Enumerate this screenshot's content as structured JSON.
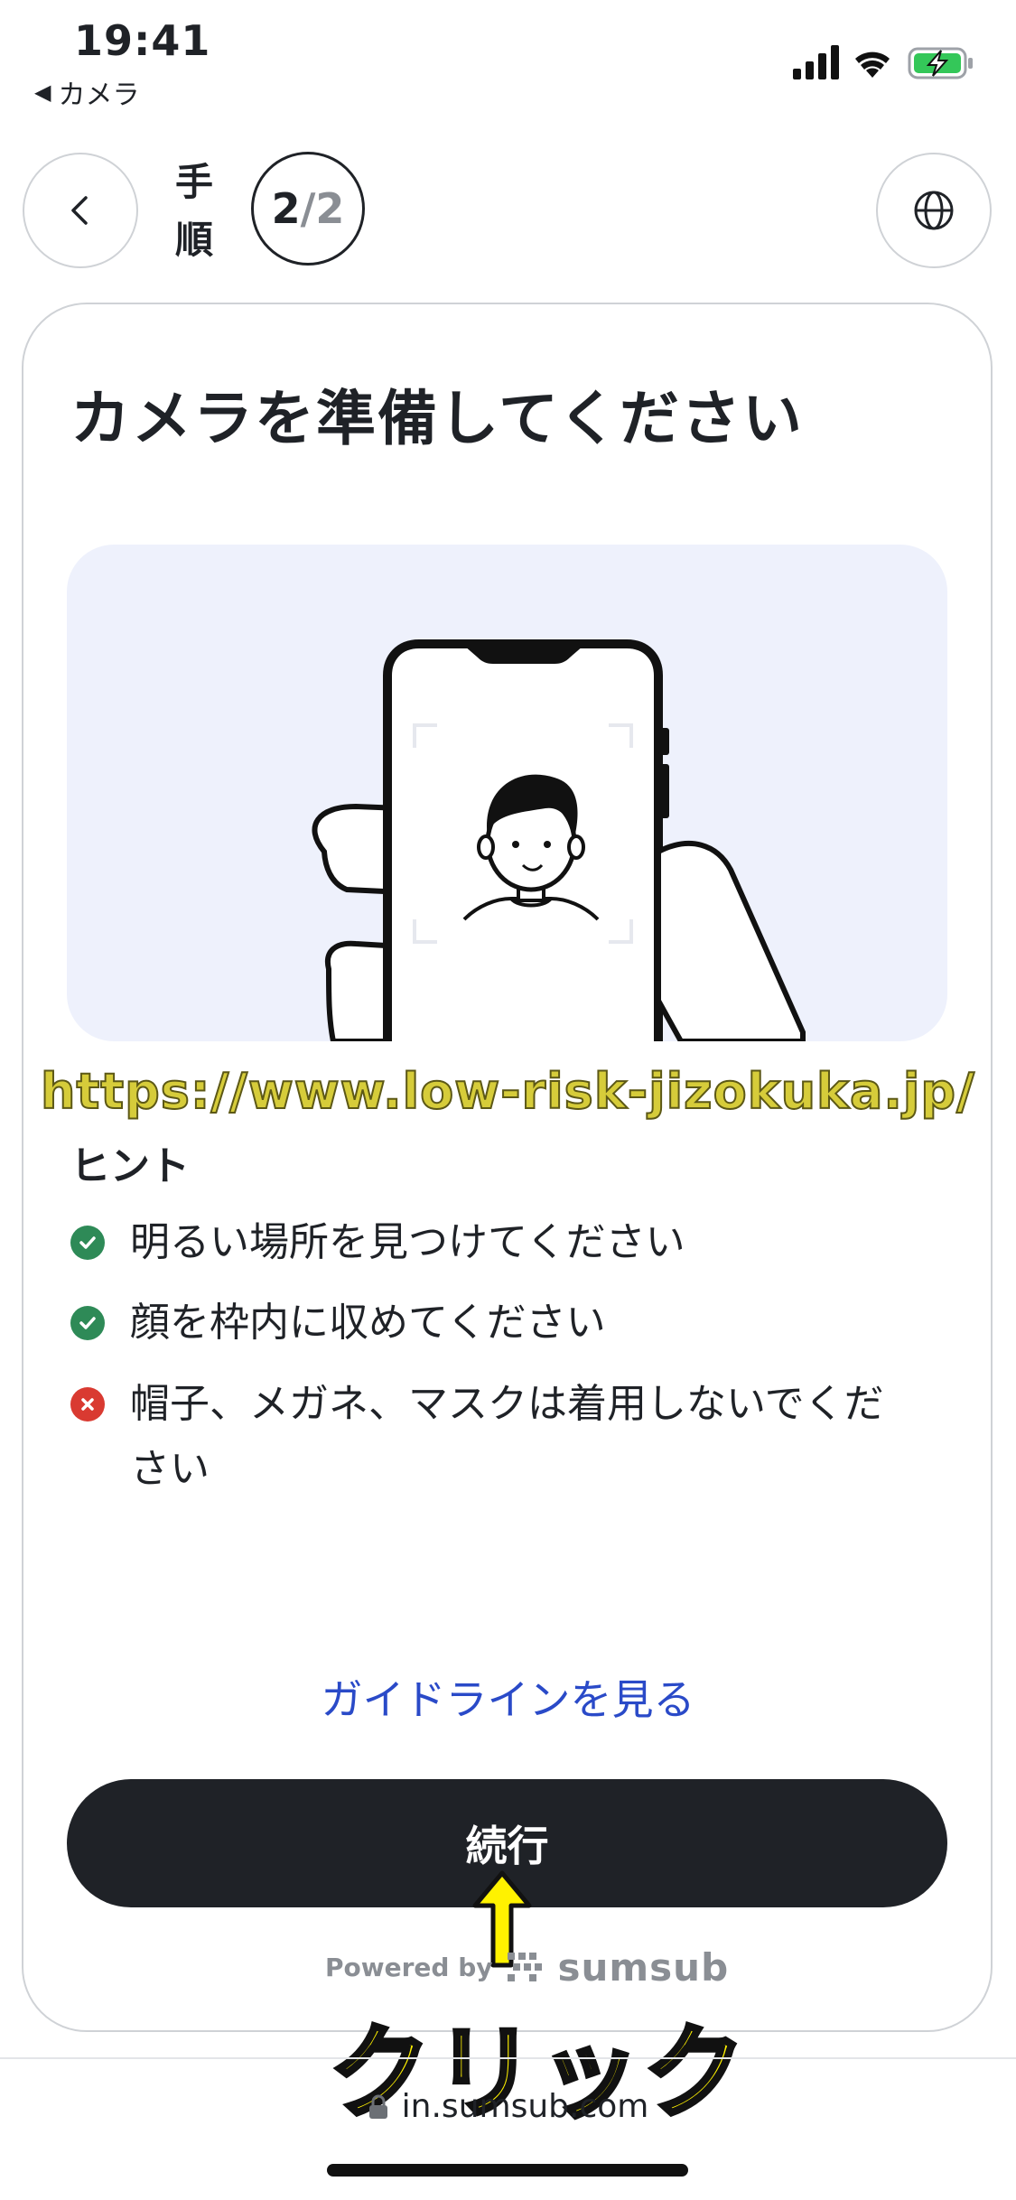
{
  "status_bar": {
    "time": "19:41",
    "back_app_label": "カメラ",
    "icons": [
      "cellular-signal-icon",
      "wifi-icon",
      "battery-charging-icon"
    ]
  },
  "nav": {
    "back_icon": "chevron-left-icon",
    "step_label": "手順",
    "step_current": "2",
    "step_separator": "/",
    "step_total": "2",
    "language_icon": "globe-icon"
  },
  "card": {
    "title": "カメラを準備してください",
    "illustration": "phone-selfie-illustration",
    "illustration_bg": "#eef1fc"
  },
  "watermark": "https://www.low-risk-jizokuka.jp/",
  "hints": {
    "heading": "ヒント",
    "items": [
      {
        "text": "明るい場所を見つけてください",
        "status": "ok"
      },
      {
        "text": "顔を枠内に収めてください",
        "status": "ok"
      },
      {
        "text": "帽子、メガネ、マスクは着用しないでください",
        "status": "ng"
      }
    ]
  },
  "guide_link": "ガイドラインを見る",
  "cta_label": "続行",
  "powered_by": {
    "prefix": "Powered by",
    "brand": "sumsub"
  },
  "annotation": {
    "label": "クリック",
    "color": "#fff200"
  },
  "url_bar": {
    "domain": "in.sumsub.com",
    "icon": "lock-icon"
  },
  "colors": {
    "primary": "#1f2227",
    "link": "#2a4ac8",
    "ok": "#2e8a57",
    "ng": "#d93a31",
    "battery": "#34c759"
  }
}
